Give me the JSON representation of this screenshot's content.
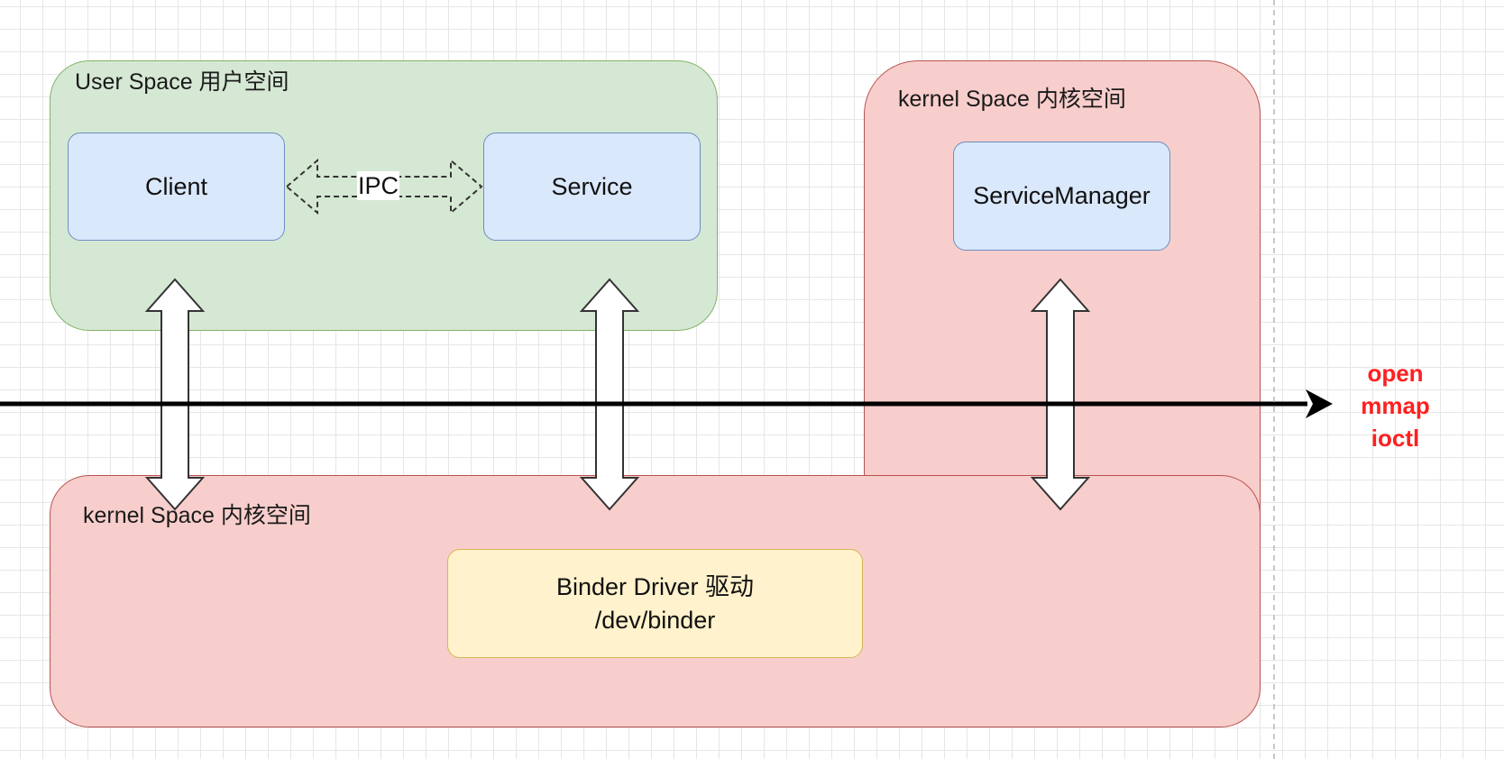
{
  "regions": {
    "user_space_label": "User Space 用户空间",
    "kernel_right_label": "kernel Space 内核空间",
    "kernel_bottom_label": "kernel Space 内核空间"
  },
  "nodes": {
    "client": "Client",
    "service": "Service",
    "service_manager": "ServiceManager",
    "binder_driver_line1": "Binder Driver 驱动",
    "binder_driver_line2": "/dev/binder"
  },
  "ipc_label": "IPC",
  "syscalls": [
    "open",
    "mmap",
    "ioctl"
  ],
  "colors": {
    "user_space_fill": "#d5e8d4",
    "kernel_fill": "#f8cecc",
    "process_fill": "#dae8fc",
    "driver_fill": "#fff2cc",
    "syscall_text": "#ff1f1f"
  }
}
